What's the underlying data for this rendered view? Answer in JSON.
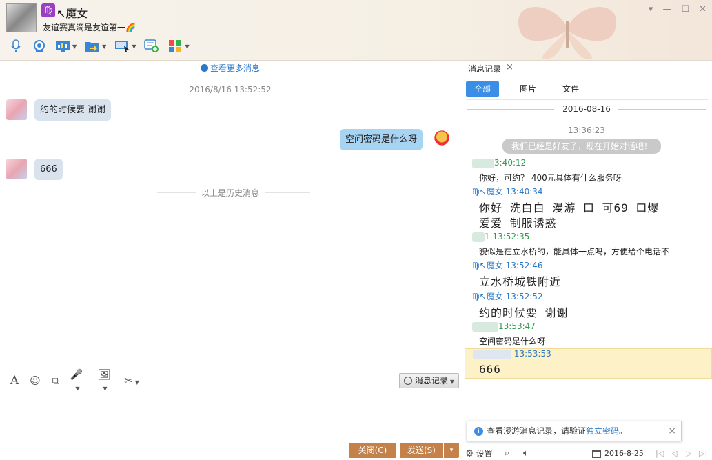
{
  "header": {
    "zodiac_symbol": "♍",
    "contact_name": "↖魔女",
    "signature": "友谊赛真滴是友谊第一🌈",
    "toolbar_icons": [
      "microphone-icon",
      "camera-icon",
      "screen-share-icon",
      "file-transfer-icon",
      "remote-desktop-icon",
      "create-group-icon",
      "apps-icon"
    ],
    "window_controls": [
      "▾",
      "—",
      "☐",
      "✕"
    ]
  },
  "chat": {
    "more_messages": "查看更多消息",
    "timestamp": "2016/8/16 13:52:52",
    "messages": [
      {
        "side": "peer",
        "text": "约的时候要 谢谢"
      },
      {
        "side": "me",
        "text": "空间密码是什么呀"
      },
      {
        "side": "peer",
        "text": "666"
      }
    ],
    "history_divider": "以上是历史消息"
  },
  "input": {
    "tools": [
      "A",
      "☺",
      "⧉",
      "🎤",
      "🖼",
      "✂"
    ],
    "record_button": "消息记录",
    "close_button": "关闭(C)",
    "send_button": "发送(S)",
    "send_arrow": "▾"
  },
  "right": {
    "tab_label": "消息记录",
    "tab_close": "×",
    "subtabs": [
      "全部",
      "图片",
      "文件"
    ],
    "date": "2016-08-16",
    "first_time": "13:36:23",
    "friend_note": "我们已经是好友了，现在开始对话吧！",
    "records": [
      {
        "who": "peer",
        "time": "3:40:12",
        "text": "你好，可约？ 400元具体有什么服务呀"
      },
      {
        "who": "self",
        "name": "♍↖魔女",
        "time": "13:40:34",
        "text_line1": "你好 洗白白 漫游 口 可69 口爆",
        "text_line2": "爱爱 制服诱惑"
      },
      {
        "who": "peer",
        "prefix": "1",
        "time": "13:52:35",
        "text": "貌似是在立水桥的，能具体一点吗，方便给个电话不"
      },
      {
        "who": "self",
        "name": "♍↖魔女",
        "time": "13:52:46",
        "text": "立水桥城铁附近"
      },
      {
        "who": "self",
        "name": "♍↖魔女",
        "time": "13:52:52",
        "text": "约的时候要 谢谢"
      },
      {
        "who": "peer",
        "time": "13:53:47",
        "text": "空间密码是什么呀"
      },
      {
        "who": "me",
        "time": "13:53:53",
        "text": "666"
      }
    ],
    "tooltip": {
      "text": "查看漫游消息记录，请验证",
      "link": "独立密码",
      "suffix": "。",
      "close": "×"
    },
    "footer": {
      "settings": "设置",
      "date": "2016-8-25",
      "nav": [
        "|◁",
        "◁",
        "▷",
        "▷|"
      ]
    }
  }
}
